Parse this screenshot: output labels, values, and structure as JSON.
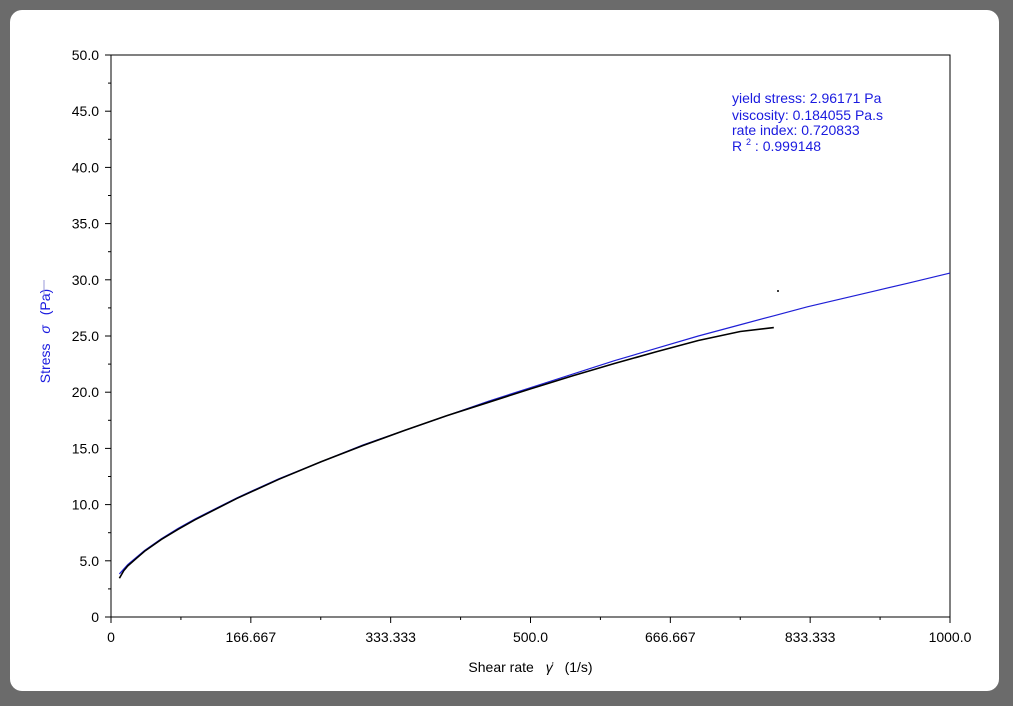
{
  "colors": {
    "fit": "#1f1fd6",
    "measured": "#000000",
    "annotation": "#1a1adf",
    "ylabel": "#1a1adf"
  },
  "chart_data": {
    "type": "line",
    "xlabel_prefix": "Shear rate",
    "xlabel_symbol": "γ̇",
    "xlabel_unit": "(1/s)",
    "ylabel_prefix": "Stress",
    "ylabel_symbol": "σ",
    "ylabel_unit": "(Pa)",
    "xlim": [
      0,
      1000
    ],
    "ylim": [
      0,
      50
    ],
    "x_ticks": [
      {
        "value": 0,
        "label": "0"
      },
      {
        "value": 166.667,
        "label": "166.667"
      },
      {
        "value": 333.333,
        "label": "333.333"
      },
      {
        "value": 500,
        "label": "500.0"
      },
      {
        "value": 666.667,
        "label": "666.667"
      },
      {
        "value": 833.333,
        "label": "833.333"
      },
      {
        "value": 1000,
        "label": "1000.0"
      }
    ],
    "y_ticks": [
      {
        "value": 0,
        "label": "0"
      },
      {
        "value": 5,
        "label": "5.0"
      },
      {
        "value": 10,
        "label": "10.0"
      },
      {
        "value": 15,
        "label": "15.0"
      },
      {
        "value": 20,
        "label": "20.0"
      },
      {
        "value": 25,
        "label": "25.0"
      },
      {
        "value": 30,
        "label": "30.0"
      },
      {
        "value": 35,
        "label": "35.0"
      },
      {
        "value": 40,
        "label": "40.0"
      },
      {
        "value": 45,
        "label": "45.0"
      },
      {
        "value": 50,
        "label": "50.0"
      }
    ],
    "grid": false,
    "legend": "none",
    "annotations": {
      "yield_stress": "yield stress: 2.96171 Pa",
      "viscosity": "viscosity: 0.184055 Pa.s",
      "rate_index": "rate index: 0.720833",
      "r2_prefix": "R",
      "r2_sup": "2",
      "r2_value": ": 0.999148"
    },
    "series": [
      {
        "x": [
          10,
          20,
          40,
          60,
          80,
          100,
          150,
          200,
          250,
          300,
          350,
          400,
          450,
          500,
          550,
          600,
          650,
          700,
          750,
          790,
          830,
          870,
          910,
          950,
          1000
        ],
        "y": [
          3.83,
          4.67,
          5.92,
          6.96,
          7.88,
          8.72,
          10.6,
          12.3,
          13.8,
          15.3,
          16.6,
          17.9,
          19.2,
          20.4,
          21.6,
          22.8,
          23.9,
          25.0,
          26.0,
          26.8,
          27.6,
          28.3,
          29.0,
          29.7,
          30.6
        ]
      },
      {
        "x": [
          10,
          15,
          20,
          30,
          40,
          60,
          80,
          100,
          150,
          200,
          250,
          300,
          350,
          400,
          450,
          500,
          550,
          600,
          650,
          700,
          750,
          790
        ],
        "y": [
          3.45,
          4.1,
          4.55,
          5.2,
          5.85,
          6.9,
          7.8,
          8.65,
          10.55,
          12.25,
          13.8,
          15.25,
          16.6,
          17.9,
          19.1,
          20.3,
          21.45,
          22.55,
          23.6,
          24.6,
          25.4,
          25.75
        ]
      },
      {
        "x": [
          795
        ],
        "y": [
          29.0
        ]
      }
    ]
  }
}
